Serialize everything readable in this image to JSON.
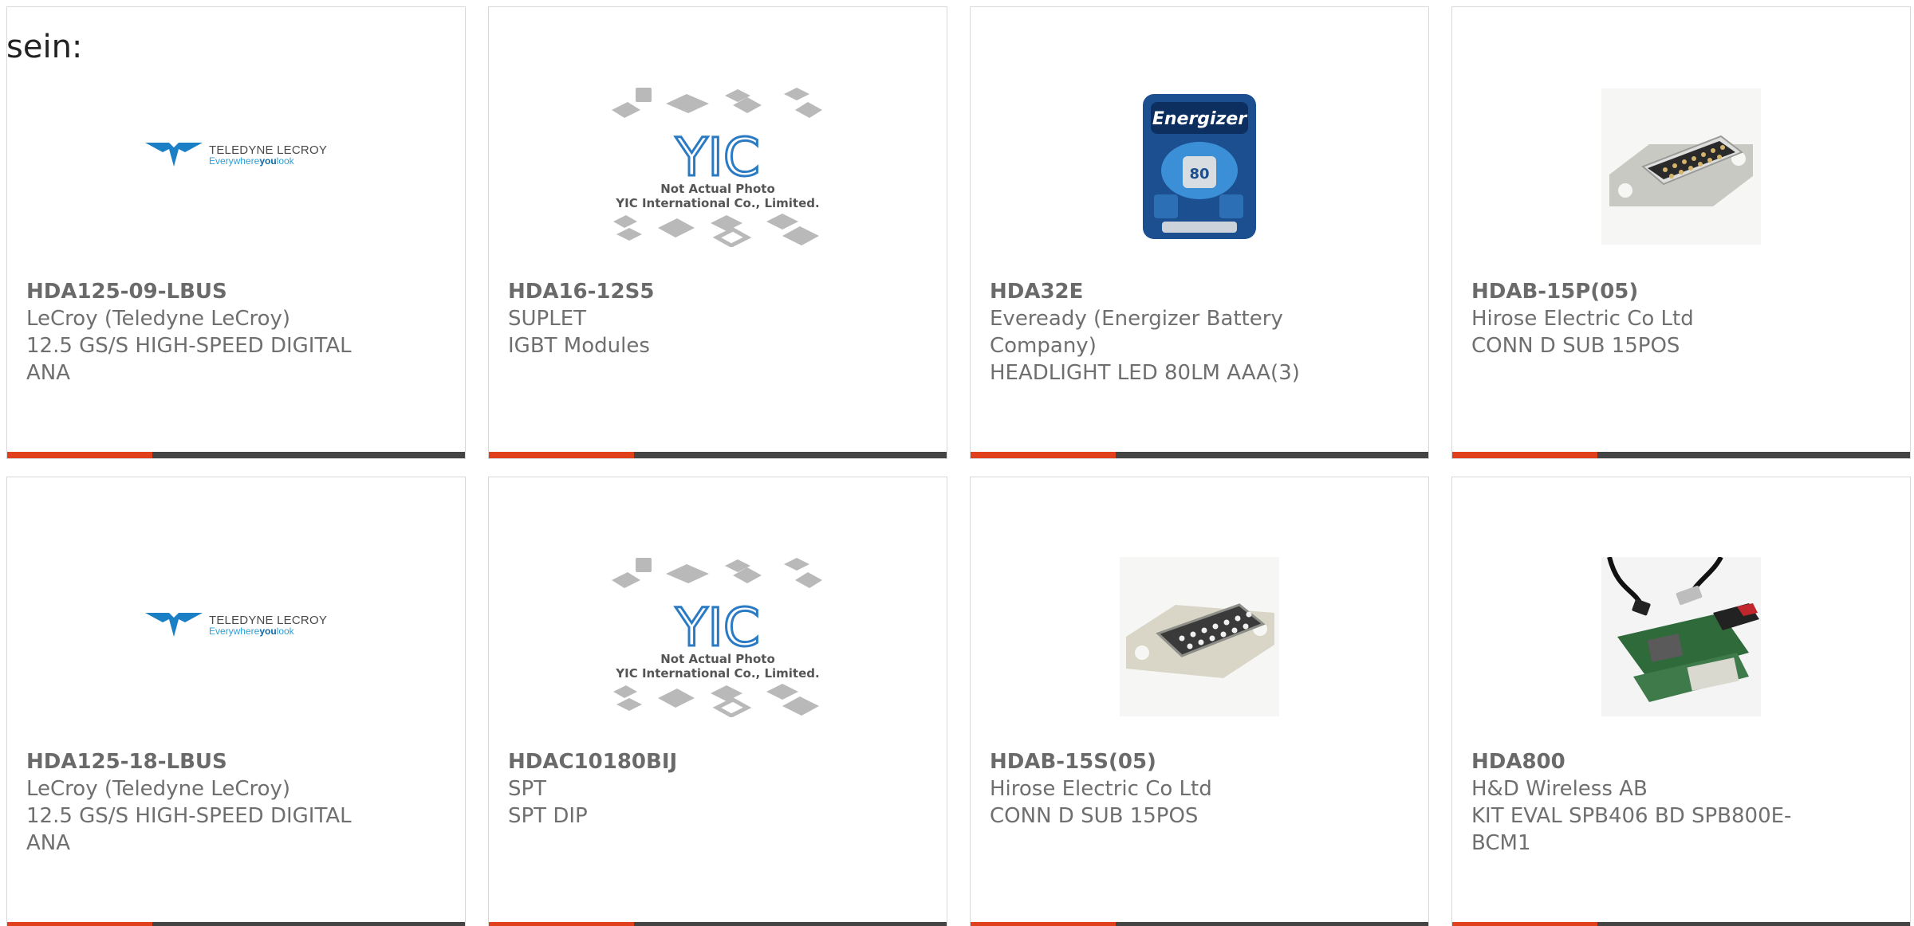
{
  "heading": "sein:",
  "products": [
    {
      "part": "HDA125-09-LBUS",
      "maker": "LeCroy (Teledyne LeCroy)",
      "desc": "12.5 GS/S HIGH-SPEED DIGITAL ANA",
      "image": "teledyne-lecroy-logo"
    },
    {
      "part": "HDA16-12S5",
      "maker": "SUPLET",
      "desc": "IGBT Modules",
      "image": "yic-placeholder"
    },
    {
      "part": "HDA32E",
      "maker": "Eveready (Energizer Battery Company)",
      "desc": "HEADLIGHT LED 80LM AAA(3)",
      "image": "energizer-headlight-photo"
    },
    {
      "part": "HDAB-15P(05)",
      "maker": "Hirose Electric Co Ltd",
      "desc": "CONN D SUB 15POS",
      "image": "dsub-male-connector-photo"
    },
    {
      "part": "HDA125-18-LBUS",
      "maker": "LeCroy (Teledyne LeCroy)",
      "desc": "12.5 GS/S HIGH-SPEED DIGITAL ANA",
      "image": "teledyne-lecroy-logo"
    },
    {
      "part": "HDAC10180BIJ",
      "maker": "SPT",
      "desc": "SPT DIP",
      "image": "yic-placeholder"
    },
    {
      "part": "HDAB-15S(05)",
      "maker": "Hirose Electric Co Ltd",
      "desc": "CONN D SUB 15POS",
      "image": "dsub-female-connector-photo"
    },
    {
      "part": "HDA800",
      "maker": "H&D Wireless AB",
      "desc": "KIT EVAL SPB406 BD SPB800E-BCM1",
      "image": "eval-kit-photo"
    }
  ],
  "logos": {
    "teledyne_top": "TELEDYNE",
    "teledyne_top2": "LECROY",
    "teledyne_sub1": "Everywhere",
    "teledyne_sub2": "you",
    "teledyne_sub3": "look",
    "yic_mark": "YIC",
    "yic_caption1": "Not Actual Photo",
    "yic_caption2": "YIC International Co., Limited.",
    "energizer_brand": "Energizer",
    "energizer_lm": "80"
  },
  "colors": {
    "accent": "#e0401c",
    "bar": "#444444",
    "text": "#6f6f6f"
  }
}
